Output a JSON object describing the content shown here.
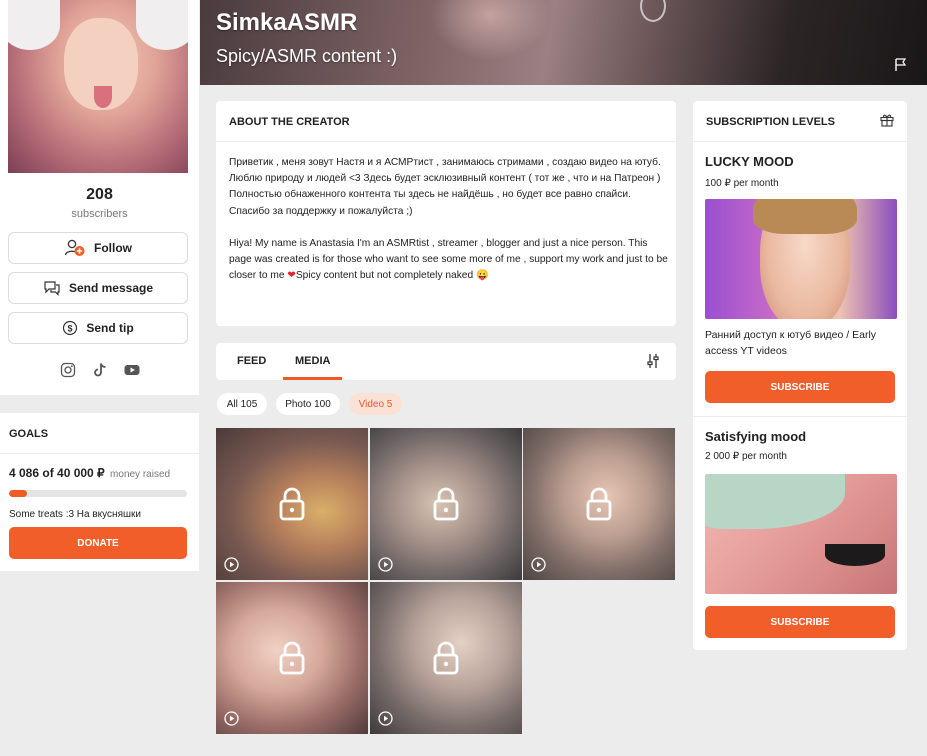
{
  "cover": {
    "title": "SimkaASMR",
    "subtitle": "Spicy/ASMR content :)",
    "flag_icon": "flag-icon"
  },
  "profile": {
    "subscribers_count": "208",
    "subscribers_label": "subscribers",
    "buttons": {
      "follow": "Follow",
      "message": "Send message",
      "tip": "Send tip"
    },
    "socials": [
      "instagram-icon",
      "tiktok-icon",
      "youtube-icon"
    ]
  },
  "goals": {
    "title": "GOALS",
    "amount": "4 086 of 40 000 ₽",
    "amount_suffix": "money raised",
    "progress_percent": 10.2,
    "description": "Some treats :3 На вкусняшки",
    "donate_label": "DONATE"
  },
  "about": {
    "title": "ABOUT THE CREATOR",
    "ru_text": "Приветик , меня зовут Настя и я АСМРтист , занимаюсь стримами , создаю видео на ютуб. Люблю природу и людей <3 Здесь будет эсклюзивный контент ( тот же , что и на Патреон ) Полностью обнаженного контента ты здесь не найдёшь , но будет все равно спайси.",
    "ru_thanks": "Спасибо за поддержку и пожалуйста ;)",
    "en_text": "Hiya! My name is Anastasia I'm an ASMRtist , streamer , blogger and just a nice person. This page was created is for those who want to see some more of me , support my work and just to be closer to me",
    "en_tail": "Spicy content but not completely naked"
  },
  "tabs": {
    "feed": "FEED",
    "media": "MEDIA",
    "active": "MEDIA"
  },
  "filters": {
    "all": "All 105",
    "photo": "Photo 100",
    "video": "Video 5",
    "active": "Video 5"
  },
  "subscription": {
    "title": "SUBSCRIPTION LEVELS",
    "tiers": [
      {
        "name": "LUCKY MOOD",
        "price": "100 ₽ per month",
        "description": "Ранний доступ к ютуб видео / Early access YT videos",
        "button": "SUBSCRIBE"
      },
      {
        "name": "Satisfying mood",
        "price": "2 000 ₽ per month",
        "description": "",
        "button": "SUBSCRIBE"
      }
    ]
  },
  "colors": {
    "accent": "#f15e2a",
    "accent_light": "#fbe1d6",
    "background": "#ececec"
  }
}
